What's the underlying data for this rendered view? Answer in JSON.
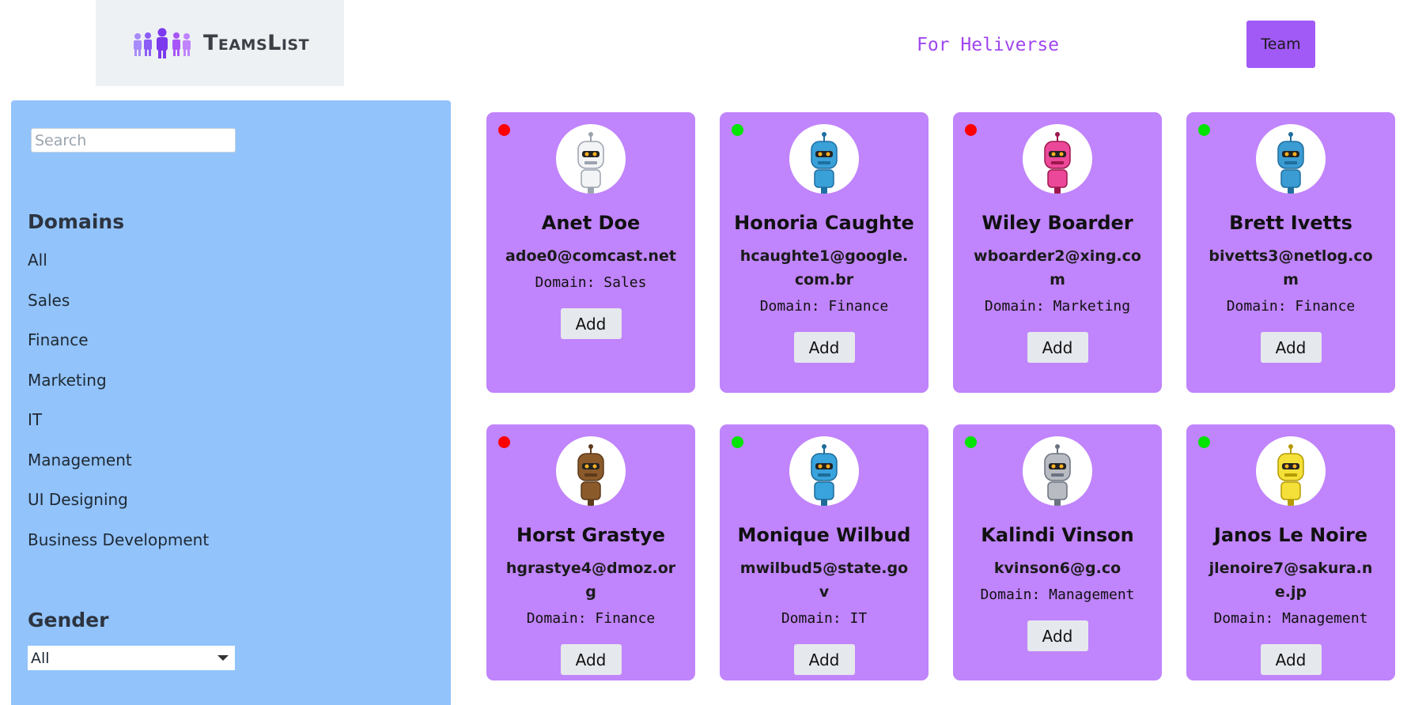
{
  "header": {
    "brand": "TeamsList",
    "tagline": "For Heliverse",
    "team_button": "Team"
  },
  "sidebar": {
    "search_placeholder": "Search",
    "domains_heading": "Domains",
    "domains": [
      "All",
      "Sales",
      "Finance",
      "Marketing",
      "IT",
      "Management",
      "UI Designing",
      "Business Development"
    ],
    "gender_heading": "Gender",
    "gender_selected": "All"
  },
  "colors": {
    "accent": "#a25af6",
    "card": "#c084fc",
    "sidebar": "#92c3fb",
    "available": "#00e400",
    "unavailable": "#ff0000"
  },
  "cards": [
    {
      "name": "Anet Doe",
      "email": "adoe0@comcast.net",
      "domain": "Domain: Sales",
      "status": "unavailable",
      "robot": "white",
      "add": "Add"
    },
    {
      "name": "Honoria Caughte",
      "email": "hcaughte1@google.com.br",
      "domain": "Domain: Finance",
      "status": "available",
      "robot": "blue",
      "add": "Add"
    },
    {
      "name": "Wiley Boarder",
      "email": "wboarder2@xing.com",
      "domain": "Domain: Marketing",
      "status": "unavailable",
      "robot": "pink",
      "add": "Add"
    },
    {
      "name": "Brett Ivetts",
      "email": "bivetts3@netlog.com",
      "domain": "Domain: Finance",
      "status": "available",
      "robot": "teal",
      "add": "Add"
    },
    {
      "name": "Horst Grastye",
      "email": "hgrastye4@dmoz.org",
      "domain": "Domain: Finance",
      "status": "unavailable",
      "robot": "brown",
      "add": "Add"
    },
    {
      "name": "Monique Wilbud",
      "email": "mwilbud5@state.gov",
      "domain": "Domain: IT",
      "status": "available",
      "robot": "blue-round",
      "add": "Add"
    },
    {
      "name": "Kalindi Vinson",
      "email": "kvinson6@g.co",
      "domain": "Domain: Management",
      "status": "available",
      "robot": "gray",
      "add": "Add"
    },
    {
      "name": "Janos Le Noire",
      "email": "jlenoire7@sakura.ne.jp",
      "domain": "Domain: Management",
      "status": "available",
      "robot": "yellow",
      "add": "Add"
    }
  ]
}
